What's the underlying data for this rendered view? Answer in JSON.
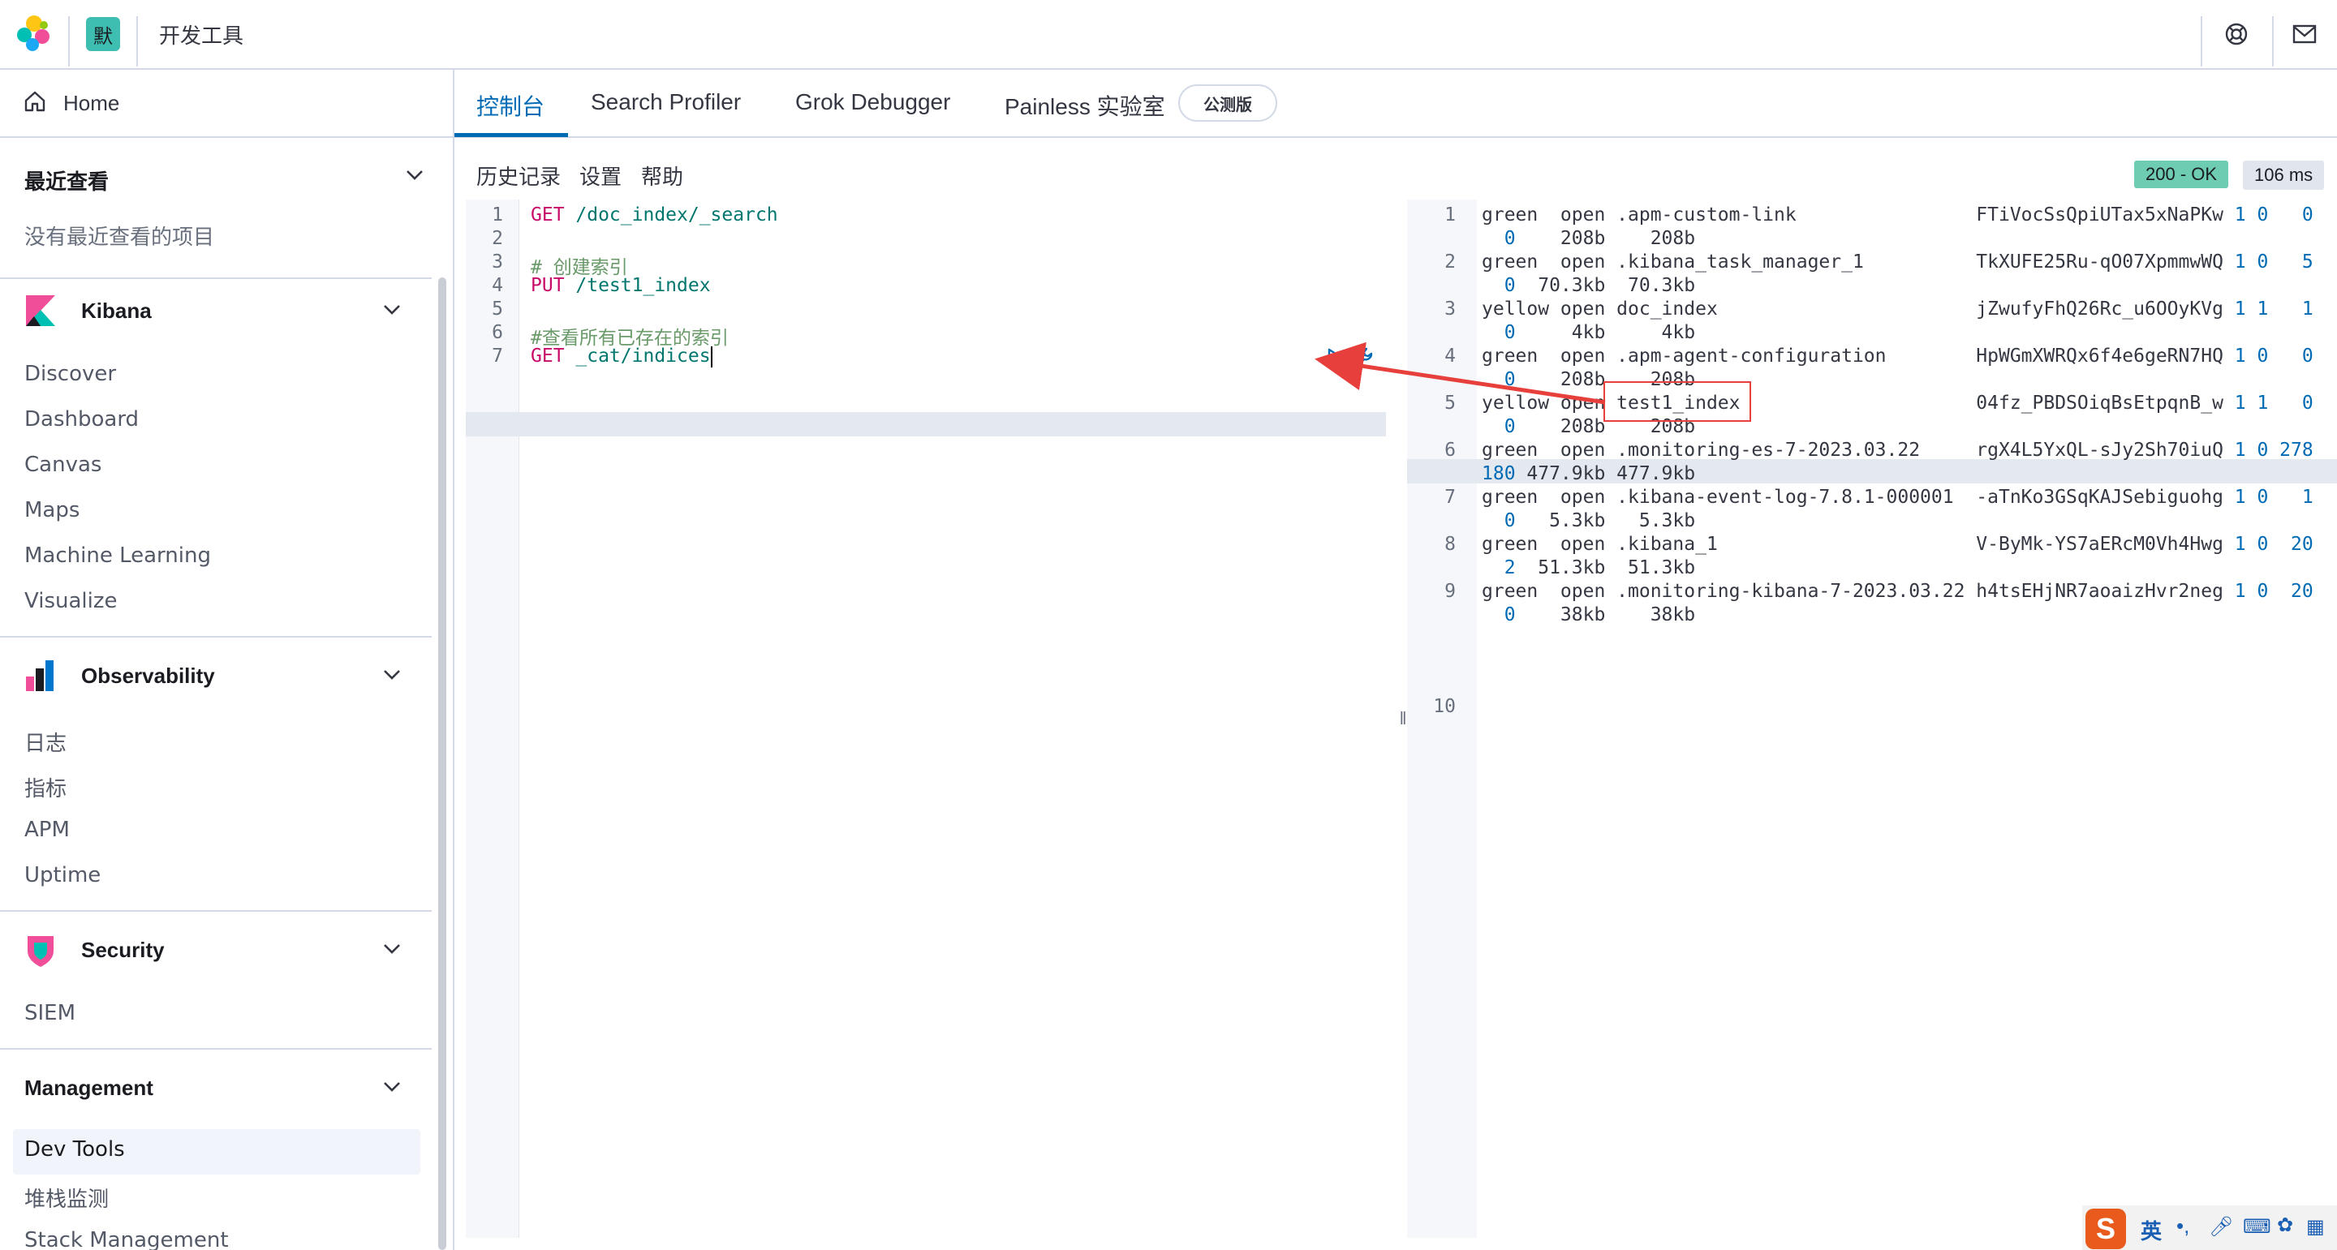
{
  "header": {
    "space_avatar": "默",
    "breadcrumb": "开发工具"
  },
  "sidenav": {
    "home": "Home",
    "recent": {
      "title": "最近查看",
      "empty": "没有最近查看的项目"
    },
    "groups": [
      {
        "title": "Kibana",
        "items": [
          "Discover",
          "Dashboard",
          "Canvas",
          "Maps",
          "Machine Learning",
          "Visualize"
        ]
      },
      {
        "title": "Observability",
        "items": [
          "日志",
          "指标",
          "APM",
          "Uptime"
        ]
      },
      {
        "title": "Security",
        "items": [
          "SIEM"
        ]
      },
      {
        "title": "Management",
        "items": [
          "Dev Tools",
          "堆栈监测",
          "Stack Management"
        ]
      }
    ]
  },
  "tabs": [
    {
      "label": "控制台"
    },
    {
      "label": "Search Profiler"
    },
    {
      "label": "Grok Debugger"
    },
    {
      "label": "Painless 实验室"
    }
  ],
  "beta_badge": "公测版",
  "console_menu": {
    "history": "历史记录",
    "settings": "设置",
    "help": "帮助"
  },
  "response_status": {
    "status": "200 - OK",
    "time": "106 ms",
    "status_color": "#6dccb1"
  },
  "request_lines": [
    {
      "n": "1",
      "method": "GET",
      "text": " /doc_index/_search"
    },
    {
      "n": "2",
      "method": "",
      "text": ""
    },
    {
      "n": "3",
      "method": "",
      "text": "# 创建索引"
    },
    {
      "n": "4",
      "method": "PUT",
      "text": " /test1_index"
    },
    {
      "n": "5",
      "method": "",
      "text": ""
    },
    {
      "n": "6",
      "method": "",
      "text": "#查看所有已存在的索引"
    },
    {
      "n": "7",
      "method": "GET",
      "text": " _cat/indices"
    }
  ],
  "response_rows": [
    {
      "n": "1",
      "health": "green ",
      "status": "open",
      "index": ".apm-custom-link",
      "uuid": "FTiVocSsQpiUTax5xNaPKw",
      "pri": "1",
      "rep": "0",
      "docs": "0",
      "deleted": "0",
      "size": "208b",
      "pri_size": "208b"
    },
    {
      "n": "2",
      "health": "green ",
      "status": "open",
      "index": ".kibana_task_manager_1",
      "uuid": "TkXUFE25Ru-qO07XpmmwWQ",
      "pri": "1",
      "rep": "0",
      "docs": "5",
      "deleted": "0",
      "size": "70.3kb",
      "pri_size": "70.3kb"
    },
    {
      "n": "3",
      "health": "yellow",
      "status": "open",
      "index": "doc_index",
      "uuid": "jZwufyFhQ26Rc_u6OOyKVg",
      "pri": "1",
      "rep": "1",
      "docs": "1",
      "deleted": "0",
      "size": "4kb",
      "pri_size": "4kb"
    },
    {
      "n": "4",
      "health": "green ",
      "status": "open",
      "index": ".apm-agent-configuration",
      "uuid": "HpWGmXWRQx6f4e6geRN7HQ",
      "pri": "1",
      "rep": "0",
      "docs": "0",
      "deleted": "0",
      "size": "208b",
      "pri_size": "208b"
    },
    {
      "n": "5",
      "health": "yellow",
      "status": "open",
      "index": "test1_index",
      "uuid": "04fz_PBDSOiqBsEtpqnB_w",
      "pri": "1",
      "rep": "1",
      "docs": "0",
      "deleted": "0",
      "size": "208b",
      "pri_size": "208b"
    },
    {
      "n": "6",
      "health": "green ",
      "status": "open",
      "index": ".monitoring-es-7-2023.03.22",
      "uuid": "rgX4L5YxQL-sJy2Sh70iuQ",
      "pri": "1",
      "rep": "0",
      "docs": "278",
      "deleted": "180",
      "size": "477.9kb",
      "pri_size": "477.9kb"
    },
    {
      "n": "7",
      "health": "green ",
      "status": "open",
      "index": ".kibana-event-log-7.8.1-000001",
      "uuid": "-aTnKo3GSqKAJSebiguohg",
      "pri": "1",
      "rep": "0",
      "docs": "1",
      "deleted": "0",
      "size": "5.3kb",
      "pri_size": "5.3kb"
    },
    {
      "n": "8",
      "health": "green ",
      "status": "open",
      "index": ".kibana_1",
      "uuid": "V-ByMk-YS7aERcM0Vh4Hwg",
      "pri": "1",
      "rep": "0",
      "docs": "20",
      "deleted": "2",
      "size": "51.3kb",
      "pri_size": "51.3kb"
    },
    {
      "n": "9",
      "health": "green ",
      "status": "open",
      "index": ".monitoring-kibana-7-2023.03.22",
      "uuid": "h4tsEHjNR7aoaizHvr2neg",
      "pri": "1",
      "rep": "0",
      "docs": "20",
      "deleted": "0",
      "size": "38kb",
      "pri_size": "38kb"
    }
  ],
  "response_last_line": "10",
  "ime": {
    "mode": "英",
    "punct": "•,"
  },
  "icons": {
    "logo": "elastic-logo-icon",
    "help": "help-lifebuoy-icon",
    "mail": "mail-icon",
    "home": "home-icon",
    "run": "play-icon",
    "wrench": "wrench-icon"
  }
}
